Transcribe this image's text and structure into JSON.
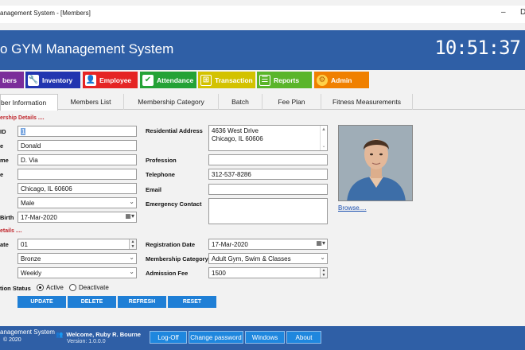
{
  "window": {
    "title": "anagement System - [Members]",
    "minimize": "–",
    "restore": "D"
  },
  "header": {
    "app_title": "o GYM Management System",
    "clock": "10:51:37"
  },
  "nav": [
    {
      "label": "bers",
      "icon": "members-icon",
      "glyph": "👥",
      "color": "#7b2d9a"
    },
    {
      "label": "Inventory",
      "icon": "inventory-icon",
      "glyph": "🔧",
      "color": "#2235b0"
    },
    {
      "label": "Employee",
      "icon": "employee-icon",
      "glyph": "👤",
      "color": "#e52424"
    },
    {
      "label": "Attendance",
      "icon": "attendance-icon",
      "glyph": "✔",
      "color": "#24a236"
    },
    {
      "label": "Transaction",
      "icon": "transaction-icon",
      "glyph": "⊞",
      "color": "#d3c200"
    },
    {
      "label": "Reports",
      "icon": "reports-icon",
      "glyph": "☰",
      "color": "#5ab52a"
    },
    {
      "label": "Admin",
      "icon": "admin-icon",
      "glyph": "⚙",
      "color": "#f08000"
    }
  ],
  "tabs": [
    "ber Information",
    "Members List",
    "Membership Category",
    "Batch",
    "Fee Plan",
    "Fitness Measurements"
  ],
  "sections": {
    "membership_details": "ership Details ....",
    "plan_details": "etails ...."
  },
  "left_labels": [
    "ID",
    "e",
    "me",
    "e",
    "Birth",
    "ate",
    "tion Status"
  ],
  "fields": {
    "member_id": "1",
    "first_name": "Donald",
    "last_name": "D. Via",
    "blank": "",
    "city": "Chicago, IL 60606",
    "gender": "Male",
    "dob": "17-Mar-2020",
    "plan_qty": "01",
    "plan_type": "Bronze",
    "plan_period": "Weekly"
  },
  "right_labels": {
    "address": "Residential Address",
    "profession": "Profession",
    "telephone": "Telephone",
    "email": "Email",
    "emergency": "Emergency Contact",
    "reg_date": "Registration Date",
    "category": "Membership Category",
    "fee": "Admission Fee"
  },
  "right_fields": {
    "address_line1": "4636 West Drive",
    "address_line2": "Chicago, IL 60606",
    "profession": "",
    "telephone": "312-537-8286",
    "email": "",
    "emergency": "",
    "reg_date": "17-Mar-2020",
    "category": "Adult Gym, Swim & Classes",
    "fee": "1500"
  },
  "status": {
    "active": "Active",
    "deactivate": "Deactivate"
  },
  "buttons": [
    "UPDATE",
    "DELETE",
    "REFRESH",
    "RESET"
  ],
  "browse": "Browse....",
  "footer": {
    "line1": "anagement System",
    "line2": "© 2020",
    "welcome": "Welcome, Ruby R. Bourne",
    "version": "Version: 1.0.0.0",
    "buttons": [
      "Log-Off",
      "Change password",
      "Windows",
      "About"
    ]
  }
}
